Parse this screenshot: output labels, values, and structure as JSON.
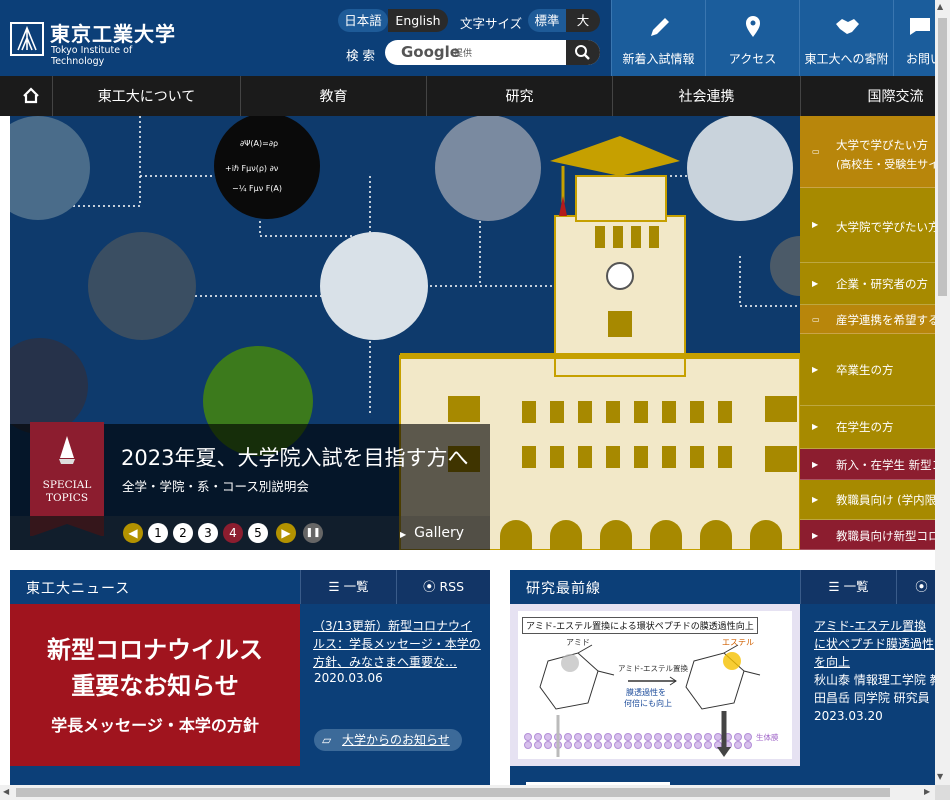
{
  "header": {
    "logo_jp": "東京工業大学",
    "logo_en": "Tokyo Institute of Technology",
    "lang_ja": "日本語",
    "lang_en": "English",
    "fontsize_label": "文字サイズ",
    "font_std": "標準",
    "font_large": "大",
    "search_label": "検 索",
    "search_brand": "Google",
    "search_provided": "提供",
    "quick": [
      {
        "label": "新着入試情報",
        "icon": "pencil-icon"
      },
      {
        "label": "アクセス",
        "icon": "map-pin-icon"
      },
      {
        "label": "東工大への寄附",
        "icon": "handshake-icon"
      },
      {
        "label": "お問い",
        "icon": "chat-icon"
      }
    ]
  },
  "nav": {
    "items": [
      "東工大について",
      "教育",
      "研究",
      "社会連携",
      "国際交流"
    ],
    "home_icon": "home-icon"
  },
  "hero": {
    "badge_line1": "SPECIAL",
    "badge_line2": "TOPICS",
    "title": "2023年夏、大学院入試を目指す方へ",
    "subtitle": "全学・学院・系・コース別説明会",
    "pages": [
      "1",
      "2",
      "3",
      "4",
      "5"
    ],
    "active_page": "4",
    "gallery": "Gallery",
    "tower_color": "#c6a000"
  },
  "side_menu": [
    {
      "label": "大学で学びたい方",
      "sub": "(高校生・受験生サイト",
      "icon": "external-icon"
    },
    {
      "label": "大学院で学びたい方",
      "icon": "arrow-icon"
    },
    {
      "label": "企業・研究者の方",
      "icon": "arrow-icon"
    },
    {
      "label": "産学連携を希望する方",
      "icon": "external-icon"
    },
    {
      "label": "卒業生の方",
      "icon": "arrow-icon"
    },
    {
      "label": "在学生の方",
      "icon": "arrow-icon"
    },
    {
      "label": "新入・在学生 新型コロナ",
      "icon": "arrow-icon"
    },
    {
      "label": "教職員向け (学内限定)",
      "icon": "arrow-icon"
    },
    {
      "label": "教職員向け新型コロナ",
      "icon": "arrow-icon"
    }
  ],
  "news": {
    "title": "東工大ニュース",
    "list_label": "一覧",
    "rss_label": "RSS",
    "banner_line1": "新型コロナウイルス",
    "banner_line2": "重要なお知らせ",
    "banner_line3": "学長メッセージ・本学の方針",
    "headline": "（3/13更新）新型コロナウイルス：学長メッセージ・本学の方針、みなさまへ重要な…",
    "date": "2020.03.06",
    "tag": "大学からのお知らせ"
  },
  "research": {
    "title": "研究最前線",
    "list_label": "一覧",
    "figure_title": "アミド-エステル置換による環状ペプチドの膜透過性向上",
    "figure_amide": "アミド",
    "figure_ester": "エステル",
    "figure_arrow": "アミド-エステル置換",
    "figure_result1": "膜透過性を",
    "figure_result2": "何倍にも向上",
    "figure_membrane": "生体膜",
    "headline": "アミド-エステル置換に状ペプチド膜透過性を向上",
    "authors1": "秋山泰 情報理工学院 教",
    "authors2": "田昌岳 同学院 研究員",
    "date": "2023.03.20"
  }
}
